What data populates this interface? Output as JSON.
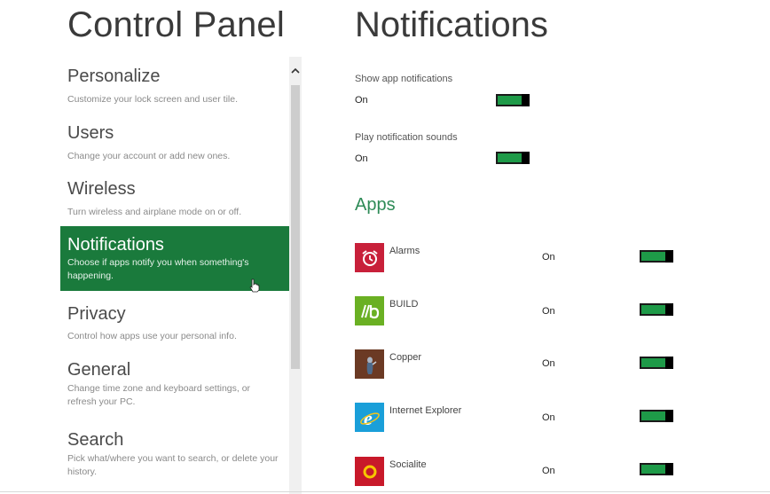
{
  "left_title": "Control Panel",
  "right_title": "Notifications",
  "colors": {
    "accent": "#1a7a3c",
    "toggle_on": "#1e9a48",
    "apps_heading": "#2e8b57"
  },
  "nav": [
    {
      "title": "Personalize",
      "desc": "Customize your lock screen and user tile.",
      "active": false
    },
    {
      "title": "Users",
      "desc": "Change your account or add new ones.",
      "active": false
    },
    {
      "title": "Wireless",
      "desc": "Turn wireless and airplane mode on or off.",
      "active": false
    },
    {
      "title": "Notifications",
      "desc": "Choose if apps notify you when something's happening.",
      "active": true
    },
    {
      "title": "Privacy",
      "desc": "Control how apps use your personal info.",
      "active": false
    },
    {
      "title": "General",
      "desc": "Change time zone and keyboard settings, or refresh your PC.",
      "active": false
    },
    {
      "title": "Search",
      "desc": "Pick what/where you want to search, or delete your history.",
      "active": false
    }
  ],
  "settings": [
    {
      "label": "Show app notifications",
      "state": "On",
      "toggle_on": true
    },
    {
      "label": "Play notification sounds",
      "state": "On",
      "toggle_on": true
    }
  ],
  "apps_heading": "Apps",
  "apps": [
    {
      "name": "Alarms",
      "state": "On",
      "icon": "alarm-clock-icon",
      "color": "#c8203a"
    },
    {
      "name": "BUILD",
      "state": "On",
      "icon": "build-icon",
      "color": "#6ab023"
    },
    {
      "name": "Copper",
      "state": "On",
      "icon": "copper-icon",
      "color": "#6b3a24"
    },
    {
      "name": "Internet Explorer",
      "state": "On",
      "icon": "internet-explorer-icon",
      "color": "#1a9fd9"
    },
    {
      "name": "Socialite",
      "state": "On",
      "icon": "socialite-icon",
      "color": "#c8192a"
    }
  ]
}
